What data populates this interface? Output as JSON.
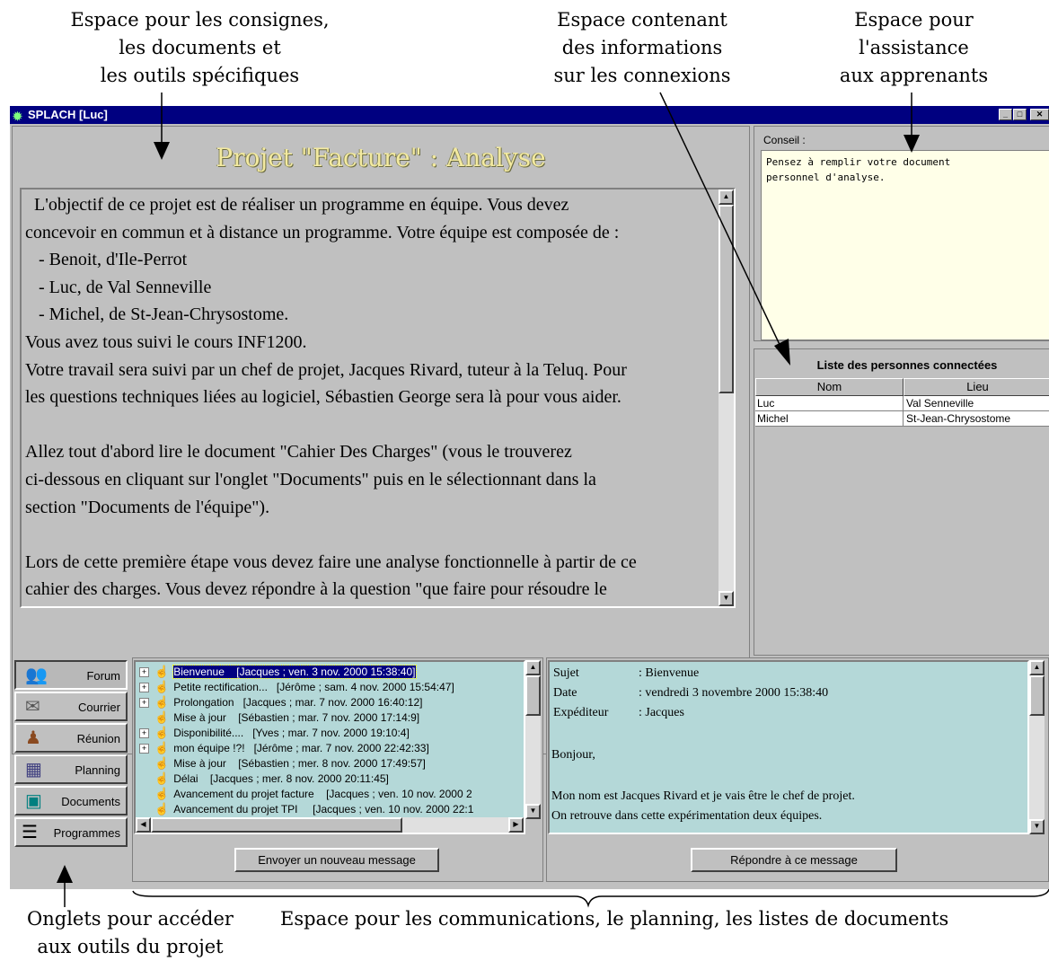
{
  "annotations": {
    "top_left": [
      "Espace pour les consignes,",
      "les documents et",
      "les outils spécifiques"
    ],
    "top_middle": [
      "Espace contenant",
      "des  informations",
      "sur les connexions"
    ],
    "top_right": [
      "Espace pour",
      "l'assistance",
      "aux apprenants"
    ],
    "bottom_left": [
      "Onglets pour accéder",
      "aux outils du projet"
    ],
    "bottom_right": "Espace pour les communications, le planning, les listes de documents"
  },
  "window": {
    "title": "SPLACH [Luc]",
    "icon": "app-splash-icon",
    "title_color": "#000080"
  },
  "main": {
    "title": "Projet \"Facture\" : Analyse",
    "lines": [
      "  L'objectif de ce projet est de réaliser un programme en équipe. Vous devez",
      "concevoir en commun et à distance un programme. Votre équipe est composée de :",
      "   - Benoit, d'Ile-Perrot",
      "   - Luc, de Val Senneville",
      "   - Michel, de St-Jean-Chrysostome.",
      "Vous avez tous suivi le cours INF1200.",
      "Votre travail sera suivi par un chef de projet, Jacques Rivard, tuteur à la Teluq. Pour",
      "les questions techniques liées au logiciel, Sébastien George sera là pour vous aider.",
      "",
      "Allez tout d'abord lire le document \"Cahier Des Charges\" (vous le trouverez",
      "ci-dessous en cliquant sur l'onglet \"Documents\" puis en le sélectionnant dans la",
      "section \"Documents de l'équipe\").",
      "",
      "Lors de cette première étape vous devez faire une analyse fonctionnelle à partir de ce",
      "cahier des charges. Vous devez répondre à la question \"que faire pour résoudre le"
    ]
  },
  "conseil": {
    "label": "Conseil :",
    "text": "Pensez à remplir votre document\npersonnel d'analyse."
  },
  "persons": {
    "title": "Liste des personnes connectées",
    "headers": [
      "Nom",
      "Lieu"
    ],
    "rows": [
      {
        "nom": "Luc",
        "lieu": "Val Senneville"
      },
      {
        "nom": "Michel",
        "lieu": "St-Jean-Chrysostome"
      }
    ]
  },
  "tabs": [
    {
      "label": "Forum",
      "icon": "forum-people-icon"
    },
    {
      "label": "Courrier",
      "icon": "mail-icon"
    },
    {
      "label": "Réunion",
      "icon": "meeting-icon"
    },
    {
      "label": "Planning",
      "icon": "calendar-icon"
    },
    {
      "label": "Documents",
      "icon": "documents-icon"
    },
    {
      "label": "Programmes",
      "icon": "program-file-icon"
    }
  ],
  "messages": [
    {
      "text": "Bienvenue    [Jacques ; ven. 3 nov. 2000 15:38:40]",
      "expandable": true,
      "selected": true
    },
    {
      "text": "Petite rectification...   [Jérôme ; sam. 4 nov. 2000 15:54:47]",
      "expandable": true
    },
    {
      "text": "Prolongation   [Jacques ; mar. 7 nov. 2000 16:40:12]",
      "expandable": true
    },
    {
      "text": "Mise à jour    [Sébastien ; mar. 7 nov. 2000 17:14:9]",
      "expandable": false
    },
    {
      "text": "Disponibilité....   [Yves ; mar. 7 nov. 2000 19:10:4]",
      "expandable": true
    },
    {
      "text": "mon équipe !?!   [Jérôme ; mar. 7 nov. 2000 22:42:33]",
      "expandable": true
    },
    {
      "text": "Mise à jour    [Sébastien ; mer. 8 nov. 2000 17:49:57]",
      "expandable": false
    },
    {
      "text": "Délai    [Jacques ; mer. 8 nov. 2000 20:11:45]",
      "expandable": false
    },
    {
      "text": "Avancement du projet facture    [Jacques ; ven. 10 nov. 2000 2",
      "expandable": false
    },
    {
      "text": "Avancement du projet TPI     [Jacques ; ven. 10 nov. 2000 22:1",
      "expandable": false
    }
  ],
  "buttons": {
    "new_message": "Envoyer un nouveau message",
    "reply": "Répondre à ce message"
  },
  "reader": {
    "sujet_key": "Sujet",
    "sujet": ": Bienvenue",
    "date_key": "Date",
    "date": ": vendredi 3 novembre 2000 15:38:40",
    "exp_key": "Expéditeur",
    "exp": ": Jacques",
    "body": [
      "Bonjour,",
      "",
      "Mon nom est Jacques Rivard et je vais être le chef de projet.",
      "On retrouve dans cette expérimentation deux équipes."
    ]
  }
}
